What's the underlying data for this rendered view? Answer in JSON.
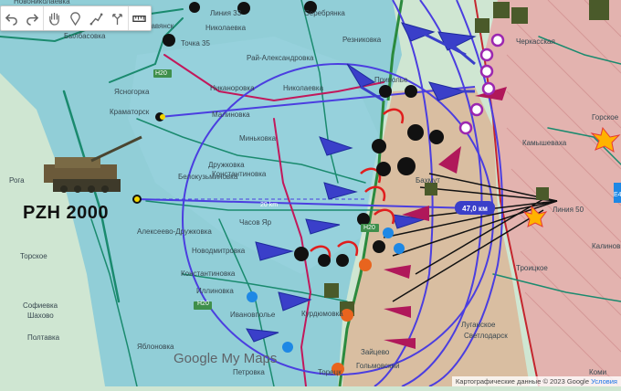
{
  "toolbar": {
    "tools": [
      {
        "name": "undo-icon"
      },
      {
        "name": "redo-icon"
      },
      {
        "name": "hand-icon"
      },
      {
        "name": "marker-icon"
      },
      {
        "name": "draw-line-icon"
      },
      {
        "name": "directions-icon"
      },
      {
        "name": "ruler-icon"
      }
    ]
  },
  "caption": "PZH 2000",
  "distance_label": "47,0 км",
  "map_labels": [
    "Новониколаевка",
    "Линия 33",
    "Серебрянка",
    "Славянск",
    "Точка 35",
    "Былбасовка",
    "Николаевка",
    "Резниковка",
    "Рай-Александровка",
    "Черкасская",
    "Никаноровка",
    "Николаевка",
    "Приволье",
    "Ясногорка",
    "Краматорск",
    "Малиновка",
    "Горское",
    "Миньковка",
    "Камышеваха",
    "Дружковка",
    "Константиновка",
    "Белокузьминовка",
    "Рога",
    "20 km",
    "Часов Яр",
    "Алексеево-Дружковка",
    "Линия 50",
    "Калиновка",
    "Торское",
    "Новодмитровка",
    "Константиновка",
    "Троицкое",
    "Софиевка",
    "Иллиновка",
    "Луганское",
    "Шахово",
    "Ивановполье",
    "Курдюмовка",
    "Полтавка",
    "Светлодарск",
    "Яблоновка",
    "Зайцево",
    "Петровка",
    "Торецк",
    "Гольмовский",
    "Коми",
    "Бахмут",
    "H20",
    "H20",
    "H20",
    "E40"
  ],
  "google_logo_word": "Google",
  "google_logo_suffix": "My Maps",
  "attribution": "Картографические данные © 2023 Google",
  "attribution_link": "Условия",
  "colors": {
    "ukrainian_control": "#86c9d8",
    "occupied": "#d9b99b",
    "occupied_hatched": "#e6a9a9",
    "background": "#cfe6d2",
    "attack_arrows": "#3a3fc9",
    "counter_arrows": "#b0185a",
    "range_circle": "#4b3ee0",
    "front_line_red": "#e01e1e",
    "fire_lines": "#111111"
  }
}
